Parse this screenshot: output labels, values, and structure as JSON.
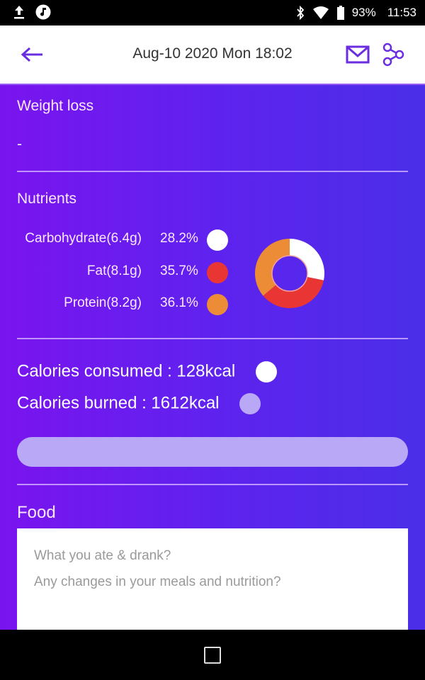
{
  "status_bar": {
    "left_icons": [
      "upload-icon",
      "music-note-icon"
    ],
    "right_icons": [
      "bluetooth-icon",
      "wifi-icon",
      "battery-icon"
    ],
    "battery": "93%",
    "time": "11:53"
  },
  "app_bar": {
    "back_icon": "arrow-left-icon",
    "title": "Aug-10 2020 Mon 18:02",
    "actions": [
      "mail-icon",
      "share-icon"
    ],
    "accent_color": "#6a2ee0"
  },
  "weight_loss": {
    "label": "Weight loss",
    "value": "-"
  },
  "nutrients": {
    "label": "Nutrients",
    "items": [
      {
        "name": "Carbohydrate(6.4g)",
        "percent": "28.2%",
        "value": 28.2,
        "color": "#ffffff"
      },
      {
        "name": "Fat(8.1g)",
        "percent": "35.7%",
        "value": 35.7,
        "color": "#ea3535"
      },
      {
        "name": "Protein(8.2g)",
        "percent": "36.1%",
        "value": 36.1,
        "color": "#ec8c36"
      }
    ]
  },
  "chart_data": {
    "type": "pie",
    "donut": true,
    "categories": [
      "Carbohydrate",
      "Fat",
      "Protein"
    ],
    "values": [
      28.2,
      35.7,
      36.1
    ],
    "colors": [
      "#ffffff",
      "#ea3535",
      "#ec8c36"
    ],
    "title": "",
    "start_angle": "top, clockwise"
  },
  "calories": {
    "consumed_label": "Calories consumed : 128kcal",
    "consumed_value": 128,
    "consumed_color": "#ffffff",
    "burned_label": "Calories burned : 1612kcal",
    "burned_value": 1612,
    "burned_color": "#b9a8f6",
    "progress_fraction": 0
  },
  "food": {
    "label": "Food",
    "placeholder_line1": "What you ate & drank?",
    "placeholder_line2": "Any changes in your meals and nutrition?"
  },
  "nav_bar": {
    "home_icon": "square-home-icon"
  }
}
